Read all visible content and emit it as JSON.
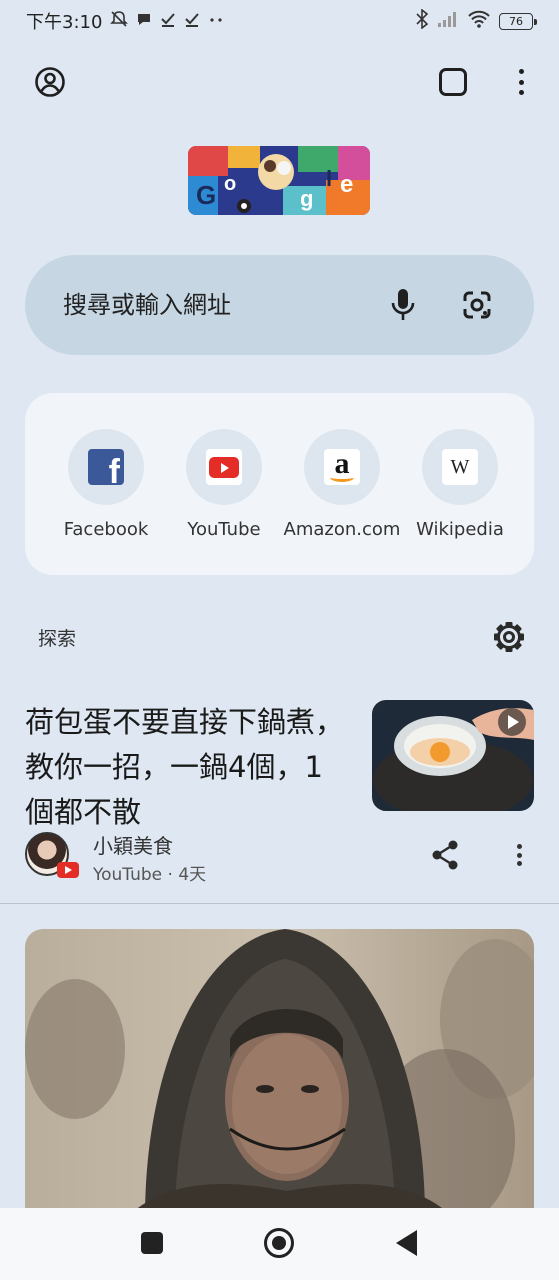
{
  "status_bar": {
    "time": "下午3:10",
    "battery": "76"
  },
  "search": {
    "placeholder": "搜尋或輸入網址"
  },
  "shortcuts": [
    {
      "label": "Facebook",
      "icon": "facebook-logo"
    },
    {
      "label": "YouTube",
      "icon": "youtube-logo"
    },
    {
      "label": "Amazon.com",
      "icon": "amazon-logo"
    },
    {
      "label": "Wikipedia",
      "icon": "wikipedia-logo"
    }
  ],
  "discover": {
    "title": "探索"
  },
  "article": {
    "title": "荷包蛋不要直接下鍋煮，教你一招，一鍋4個，1個都不散",
    "source": "小穎美食",
    "meta": "YouTube · 4天"
  },
  "colors": {
    "background": "#dfe8f2",
    "search_bg": "#c6d7e3",
    "shortcuts_bg": "#f1f5fa",
    "youtube_red": "#e52d27",
    "facebook_blue": "#3b5998"
  }
}
